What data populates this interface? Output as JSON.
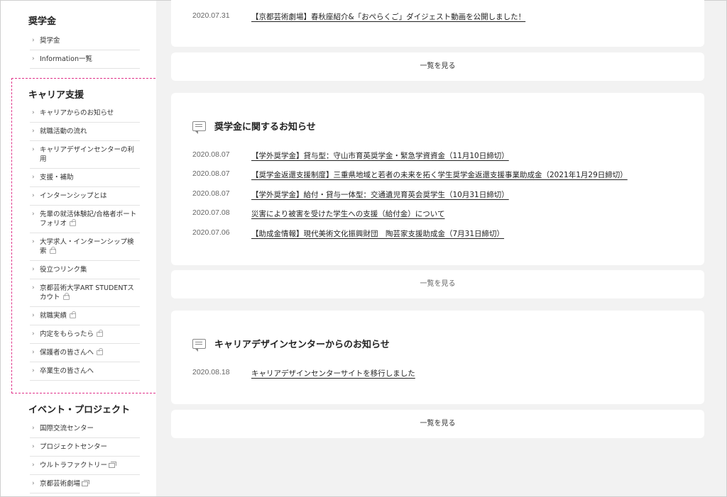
{
  "sidebar": {
    "sections": [
      {
        "title": "奨学金",
        "items": [
          {
            "label": "奨学金",
            "icon": ""
          },
          {
            "label": "Information一覧",
            "icon": ""
          }
        ]
      },
      {
        "title": "キャリア支援",
        "items": [
          {
            "label": "キャリアからのお知らせ",
            "icon": ""
          },
          {
            "label": "就職活動の流れ",
            "icon": ""
          },
          {
            "label": "キャリアデザインセンターの利用",
            "icon": ""
          },
          {
            "label": "支援・補助",
            "icon": ""
          },
          {
            "label": "インターンシップとは",
            "icon": ""
          },
          {
            "label": "先輩の就活体験記/合格者ポートフォリオ",
            "icon": "lock-icon"
          },
          {
            "label": "大学求人・インターンシップ検索",
            "icon": "lock-icon"
          },
          {
            "label": "役立つリンク集",
            "icon": ""
          },
          {
            "label": "京都芸術大学ART STUDENTスカウト",
            "icon": "lock-icon"
          },
          {
            "label": "就職実績",
            "icon": "lock-icon"
          },
          {
            "label": "内定をもらったら",
            "icon": "lock-icon"
          },
          {
            "label": "保護者の皆さんへ",
            "icon": "lock-icon"
          },
          {
            "label": "卒業生の皆さんへ",
            "icon": ""
          }
        ]
      },
      {
        "title": "イベント・プロジェクト",
        "items": [
          {
            "label": "国際交流センター",
            "icon": ""
          },
          {
            "label": "プロジェクトセンター",
            "icon": ""
          },
          {
            "label": "ウルトラファクトリー",
            "icon": "external-link-icon"
          },
          {
            "label": "京都芸術劇場",
            "icon": "external-link-icon"
          }
        ]
      }
    ]
  },
  "main": {
    "top_card": {
      "rows": [
        {
          "date": "2020.07.31",
          "text": "【京都芸術劇場】春秋座紹介&「おぺらくご」ダイジェスト動画を公開しました！"
        }
      ],
      "more_label": "一覧を見る"
    },
    "scholarship_card": {
      "title": "奨学金に関するお知らせ",
      "rows": [
        {
          "date": "2020.08.07",
          "text": "【学外奨学金】貸与型：守山市育英奨学金・緊急学資資金（11月10日締切）"
        },
        {
          "date": "2020.08.07",
          "text": "【奨学金返還支援制度】三重県地域と若者の未来を拓く学生奨学金返還支援事業助成金（2021年1月29日締切）"
        },
        {
          "date": "2020.08.07",
          "text": "【学外奨学金】給付・貸与一体型：交通遺児育英会奨学生（10月31日締切）"
        },
        {
          "date": "2020.07.08",
          "text": "災害により被害を受けた学生への支援（給付金）について"
        },
        {
          "date": "2020.07.06",
          "text": "【助成金情報】現代美術文化振興財団　陶芸家支援助成金（7月31日締切）"
        }
      ],
      "more_label": "一覧を見る"
    },
    "career_card": {
      "title": "キャリアデザインセンターからのお知らせ",
      "rows": [
        {
          "date": "2020.08.18",
          "text": "キャリアデザインセンターサイトを移行しました"
        }
      ],
      "more_label": "一覧を見る"
    }
  },
  "colors": {
    "highlight_border": "#e0338a",
    "main_background": "#f2f2f2"
  }
}
